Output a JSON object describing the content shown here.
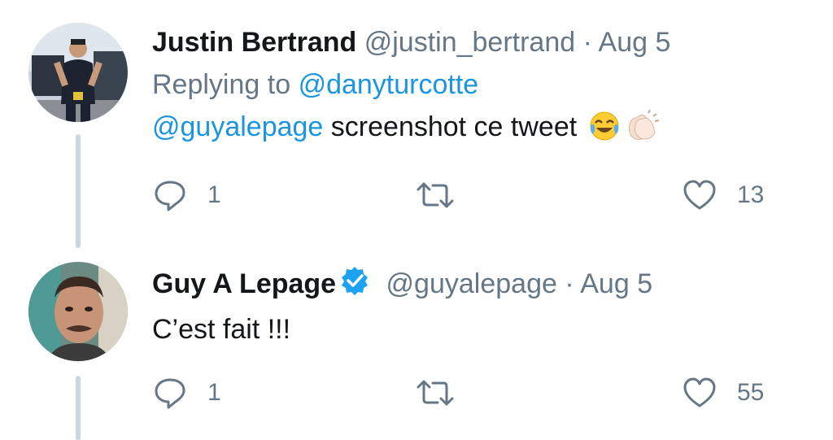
{
  "tweets": [
    {
      "name": "Justin Bertrand",
      "handle": "@justin_bertrand",
      "separator": "·",
      "date": "Aug 5",
      "replying_label": "Replying to",
      "replying_to": "@danyturcotte",
      "mention": "@guyalepage",
      "text": "screenshot ce tweet",
      "emojis": [
        "face-with-tears-of-joy",
        "clapping-hands"
      ],
      "reply_count": "1",
      "like_count": "13",
      "verified": false
    },
    {
      "name": "Guy A Lepage",
      "handle": "@guyalepage",
      "separator": "·",
      "date": "Aug 5",
      "text": "C’est fait !!!",
      "reply_count": "1",
      "like_count": "55",
      "verified": true
    }
  ],
  "colors": {
    "link": "#1b95e0",
    "secondary": "#657786",
    "primary_text": "#14171a",
    "thread_line": "#ccd6dd",
    "verified": "#1da1f2"
  },
  "icons": [
    "reply-icon",
    "retweet-icon",
    "like-icon",
    "verified-badge-icon"
  ]
}
